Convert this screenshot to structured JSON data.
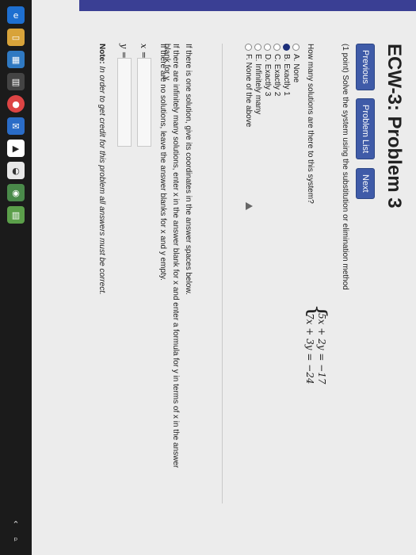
{
  "taskbar": {
    "icons": [
      "edge-icon",
      "folder-icon",
      "store-icon",
      "calculator-icon",
      "chrome-icon",
      "mail-icon",
      "media-icon",
      "app-icon",
      "security-icon",
      "notes-icon"
    ],
    "tray": [
      "⌃",
      "ᵖ"
    ]
  },
  "problem": {
    "title": "ECW-3: Problem 3",
    "nav": {
      "previous": "Previous",
      "problem_list": "Problem List",
      "next": "Next"
    },
    "statement": "(1 point) Solve the system using the substitution or elimination method",
    "system": [
      "5x + 2y = −17",
      "7x + 3y = −24"
    ],
    "question": "How many solutions are there to this system?",
    "options": [
      {
        "label": "A. None",
        "selected": false
      },
      {
        "label": "B. Exactly 1",
        "selected": true
      },
      {
        "label": "C. Exactly 2",
        "selected": false
      },
      {
        "label": "D. Exactly 3",
        "selected": false
      },
      {
        "label": "E. Infinitely many",
        "selected": false
      },
      {
        "label": "F. None of the above",
        "selected": false
      }
    ],
    "instructions": [
      "If there is one solution, give its coordinates in the answer spaces below.",
      "If there are infinitely many solutions, enter x in the answer blank for x and enter a formula for y in terms of x in the answer blank for y.",
      "If there are no solutions, leave the answer blanks for x and y empty."
    ],
    "answers": {
      "x_label": "x =",
      "y_label": "y =",
      "x_value": "",
      "y_value": ""
    },
    "note_prefix": "Note:",
    "note": "In order to get credit for this problem all answers must be correct."
  }
}
